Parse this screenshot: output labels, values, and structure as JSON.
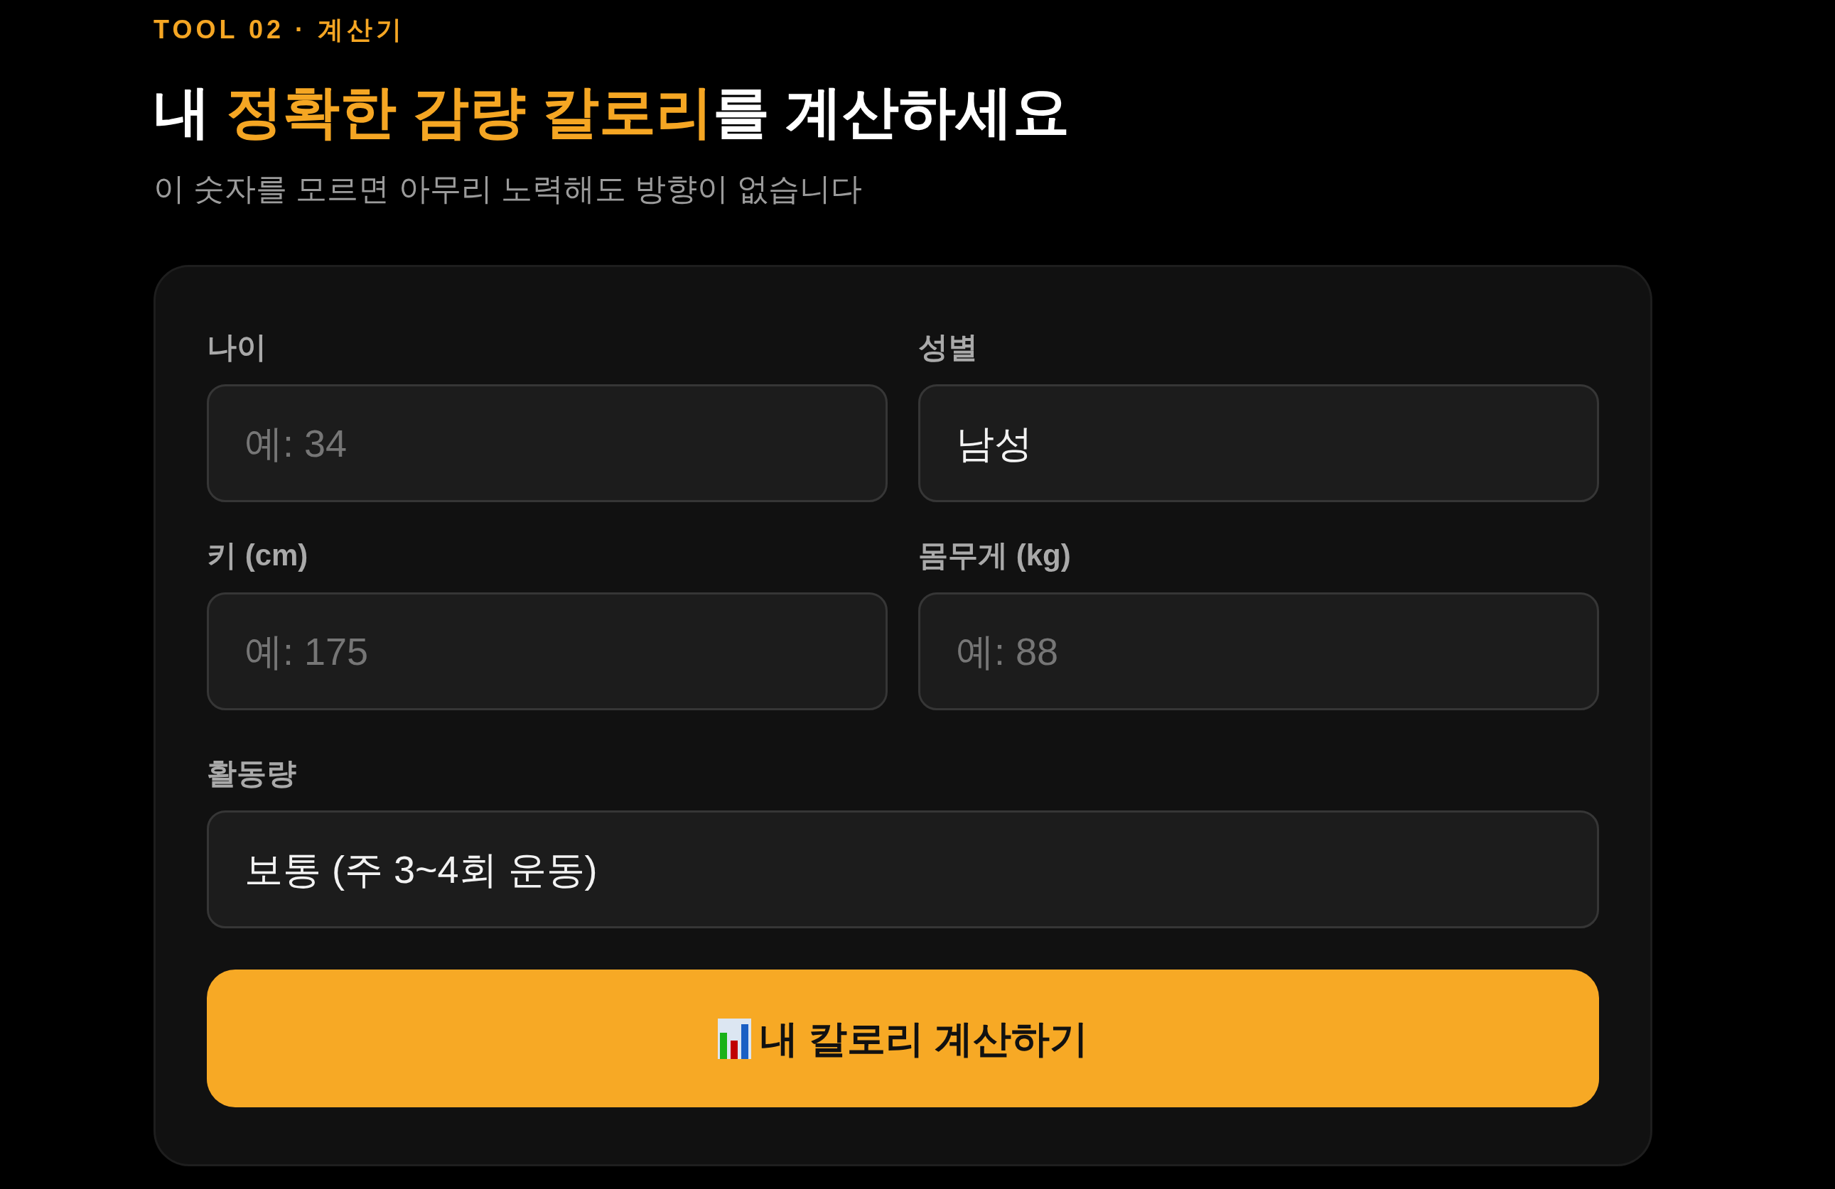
{
  "eyebrow": "TOOL 02 · 계산기",
  "title_parts": [
    {
      "text": "내 ",
      "highlight": false
    },
    {
      "text": "정확한 감량 칼로리",
      "highlight": true
    },
    {
      "text": "를 계산하세요",
      "highlight": false
    }
  ],
  "subtitle": "이 숫자를 모르면 아무리 노력해도 방향이 없습니다",
  "form": {
    "rows": [
      [
        {
          "label": "나이",
          "kind": "input",
          "placeholder": "예: 34"
        },
        {
          "label": "성별",
          "kind": "select",
          "value": "남성"
        }
      ],
      [
        {
          "label": "키 (cm)",
          "kind": "input",
          "placeholder": "예: 175"
        },
        {
          "label": "몸무게 (kg)",
          "kind": "input",
          "placeholder": "예: 88"
        }
      ],
      [
        {
          "label": "활동량",
          "kind": "select",
          "value": "보통 (주 3~4회 운동)"
        }
      ]
    ],
    "submit_button": {
      "label": "내 칼로리 계산하기"
    }
  }
}
